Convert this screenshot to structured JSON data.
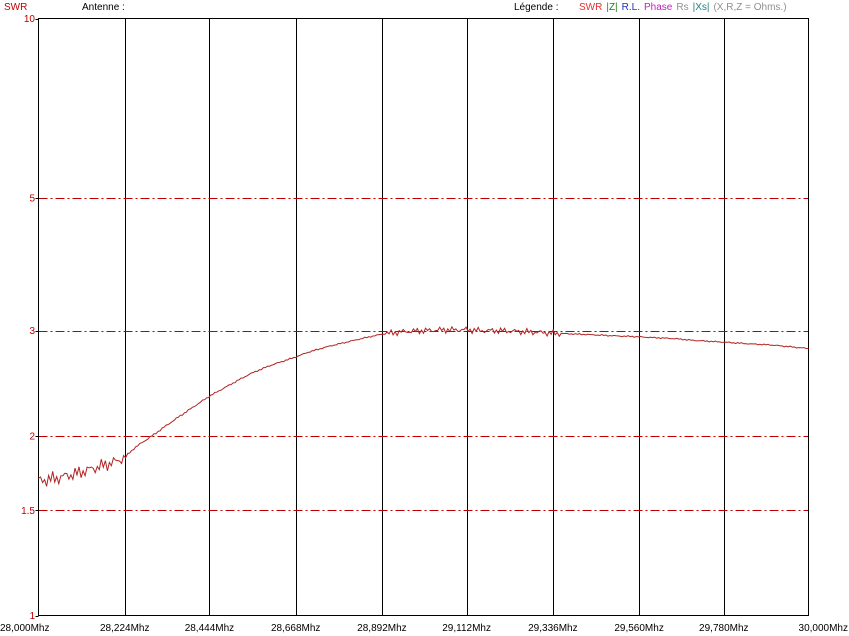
{
  "header": {
    "y_axis_name": "SWR",
    "antenna_label": "Antenne :",
    "legend_label": "Légende :",
    "legend_items": [
      {
        "text": "SWR",
        "color": "#e03030"
      },
      {
        "text": "|Z|",
        "color": "#208020"
      },
      {
        "text": "R.L.",
        "color": "#2030c0"
      },
      {
        "text": "Phase",
        "color": "#c020c0"
      },
      {
        "text": "Rs",
        "color": "#909090"
      },
      {
        "text": "|Xs|",
        "color": "#208080"
      },
      {
        "text": "(X,R,Z = Ohms.)",
        "color": "#909090"
      }
    ]
  },
  "chart_data": {
    "type": "line",
    "title": "",
    "xlabel": "",
    "ylabel": "SWR",
    "x_unit": "Mhz",
    "xlim": [
      28.0,
      30.0
    ],
    "ylim": [
      1,
      10
    ],
    "y_scale": "log",
    "x_ticks": [
      "28,000Mhz",
      "28,224Mhz",
      "28,444Mhz",
      "28,668Mhz",
      "28,892Mhz",
      "29,112Mhz",
      "29,336Mhz",
      "29,560Mhz",
      "29,780Mhz",
      "30,000Mhz"
    ],
    "x_tick_values": [
      28.0,
      28.224,
      28.444,
      28.668,
      28.892,
      29.112,
      29.336,
      29.56,
      29.78,
      30.0
    ],
    "y_ticks": [
      "10",
      "5",
      "3",
      "2",
      "1.5",
      "1"
    ],
    "y_tick_values": [
      10,
      5,
      3,
      2,
      1.5,
      1
    ],
    "grid": {
      "vertical": "solid",
      "horizontal": "dash-dot"
    },
    "colors": {
      "grid_vertical": "#000000",
      "grid_horizontal": "#c00000",
      "series": "#b22222",
      "ytick_label": "#c00000"
    },
    "series": [
      {
        "name": "SWR",
        "x": [
          28.0,
          28.05,
          28.1,
          28.15,
          28.2,
          28.224,
          28.25,
          28.3,
          28.35,
          28.4,
          28.444,
          28.5,
          28.55,
          28.6,
          28.668,
          28.7,
          28.75,
          28.8,
          28.85,
          28.892,
          28.95,
          29.0,
          29.05,
          29.112,
          29.15,
          29.2,
          29.25,
          29.3,
          29.336,
          29.4,
          29.45,
          29.5,
          29.56,
          29.6,
          29.65,
          29.7,
          29.78,
          29.85,
          29.9,
          29.95,
          30.0
        ],
        "values": [
          1.68,
          1.7,
          1.73,
          1.77,
          1.81,
          1.84,
          1.91,
          2.01,
          2.12,
          2.23,
          2.33,
          2.44,
          2.54,
          2.62,
          2.71,
          2.76,
          2.82,
          2.87,
          2.92,
          2.96,
          2.99,
          3.0,
          3.01,
          3.01,
          3.0,
          3.0,
          2.99,
          2.98,
          2.97,
          2.96,
          2.95,
          2.94,
          2.93,
          2.92,
          2.91,
          2.89,
          2.87,
          2.85,
          2.84,
          2.82,
          2.8
        ]
      }
    ]
  }
}
